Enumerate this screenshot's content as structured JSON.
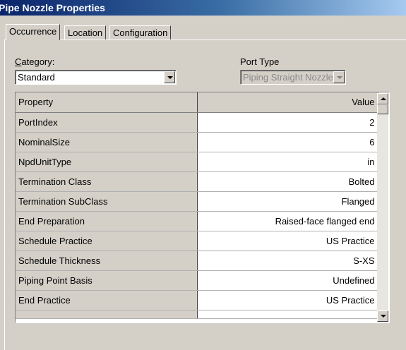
{
  "window": {
    "title": "Pipe Nozzle Properties"
  },
  "tabs": [
    {
      "label": "Occurrence",
      "active": true
    },
    {
      "label": "Location",
      "active": false
    },
    {
      "label": "Configuration",
      "active": false
    }
  ],
  "category": {
    "label": "Category:",
    "value": "Standard"
  },
  "port_type": {
    "label": "Port Type",
    "value": "Piping Straight Nozzle",
    "disabled": true
  },
  "grid": {
    "headers": {
      "property": "Property",
      "value": "Value"
    },
    "rows": [
      {
        "property": "PortIndex",
        "value": "2"
      },
      {
        "property": "NominalSize",
        "value": "6"
      },
      {
        "property": "NpdUnitType",
        "value": "in"
      },
      {
        "property": "Termination Class",
        "value": "Bolted"
      },
      {
        "property": "Termination SubClass",
        "value": "Flanged"
      },
      {
        "property": "End Preparation",
        "value": "Raised-face flanged end"
      },
      {
        "property": "Schedule Practice",
        "value": "US Practice"
      },
      {
        "property": "Schedule Thickness",
        "value": "S-XS"
      },
      {
        "property": "Piping Point Basis",
        "value": "Undefined"
      },
      {
        "property": "End Practice",
        "value": "US Practice"
      }
    ]
  },
  "icons": {
    "dropdown": "chevron-down-icon",
    "scroll_up": "arrow-up-icon",
    "scroll_down": "arrow-down-icon"
  },
  "colors": {
    "title_bar_start": "#0a246a",
    "title_bar_end": "#a6caf0",
    "dialog_bg": "#d4d0c8"
  }
}
